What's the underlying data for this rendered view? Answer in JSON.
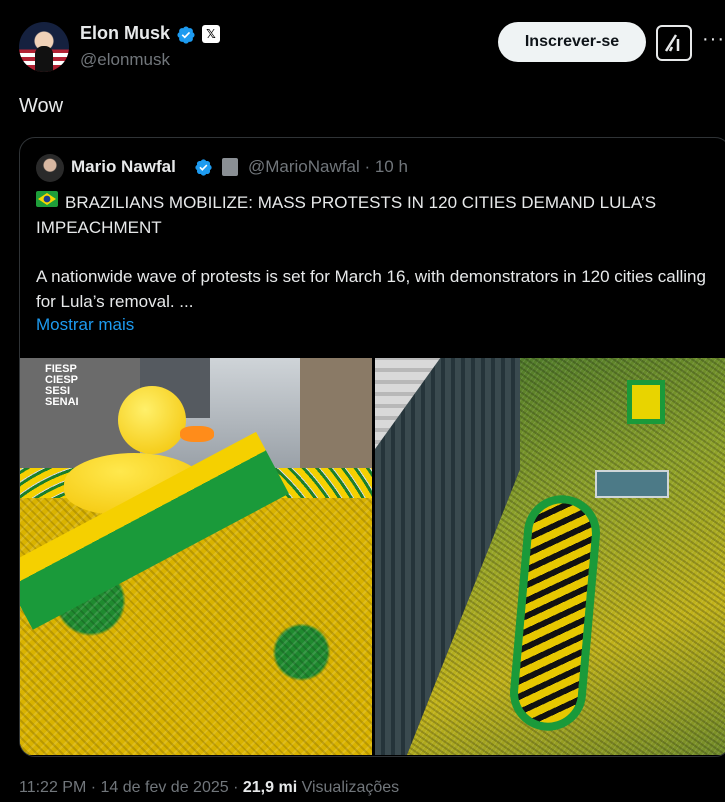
{
  "author": {
    "name": "Elon Musk",
    "handle": "@elonmusk",
    "badge_icon": "x-logo-icon"
  },
  "actions": {
    "subscribe_label": "Inscrever-se"
  },
  "tweet": {
    "text": "Wow"
  },
  "quoted": {
    "name": "Mario Nawfal",
    "handle_time": "@MarioNawfal · 10 h",
    "headline": "BRAZILIANS MOBILIZE: MASS PROTESTS IN 120 CITIES DEMAND LULA’S IMPEACHMENT",
    "body": "A nationwide wave of protests is set for March 16, with demonstrators in 120 cities calling for Lula’s removal. ...",
    "show_more": "Mostrar mais",
    "image_left_sign": "FIESP CIESP SESI SENAI"
  },
  "meta": {
    "time": "11:22 PM",
    "date": "14 de fev de 2025",
    "views_count": "21,9 mi",
    "views_label": "Visualizações"
  },
  "colors": {
    "background": "#000000",
    "link": "#1d9bf0",
    "verified": "#1d9bf0",
    "muted": "#71767b"
  }
}
